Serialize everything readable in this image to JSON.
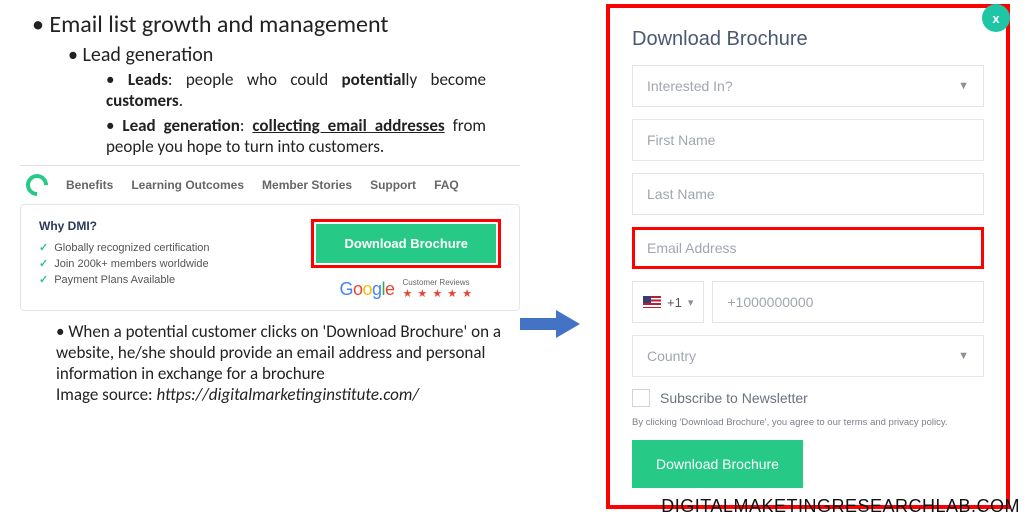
{
  "slide": {
    "title": "Email list growth and management",
    "sub1": "Lead generation",
    "leads_def_parts": {
      "a": "Leads",
      "b": ": people who could ",
      "c": "potential",
      "d": "ly become ",
      "e": "customers",
      "f": "."
    },
    "leadgen_def_parts": {
      "a": "Lead generation",
      "b": ": ",
      "c": "collecting email addresses",
      "d": " from people you hope to turn into customers."
    },
    "caption1": "When a potential customer clicks on 'Download Brochure' on a website, he/she should provide an email address and personal information in exchange for a brochure",
    "caption2_prefix": "Image source: ",
    "caption2_url": "https://digitalmarketinginstitute.com/"
  },
  "dmi": {
    "nav": [
      "Benefits",
      "Learning Outcomes",
      "Member Stories",
      "Support",
      "FAQ"
    ],
    "why_title": "Why DMI?",
    "features": [
      "Globally recognized certification",
      "Join 200k+ members worldwide",
      "Payment Plans Available"
    ],
    "download_btn": "Download Brochure",
    "google_letters": [
      "G",
      "o",
      "o",
      "g",
      "l",
      "e"
    ],
    "reviews_label": "Customer Reviews",
    "stars": "★ ★ ★ ★ ★"
  },
  "form": {
    "close": "x",
    "title": "Download Brochure",
    "interested": "Interested In?",
    "first_name": "First Name",
    "last_name": "Last Name",
    "email": "Email Address",
    "dial_code": "+1",
    "phone_placeholder": "+1000000000",
    "country": "Country",
    "subscribe": "Subscribe to Newsletter",
    "terms": "By clicking 'Download Brochure', you agree to our terms and privacy policy.",
    "submit": "Download Brochure"
  },
  "watermark": "DIGITALMAKETINGRESEARCHLAB.COM"
}
